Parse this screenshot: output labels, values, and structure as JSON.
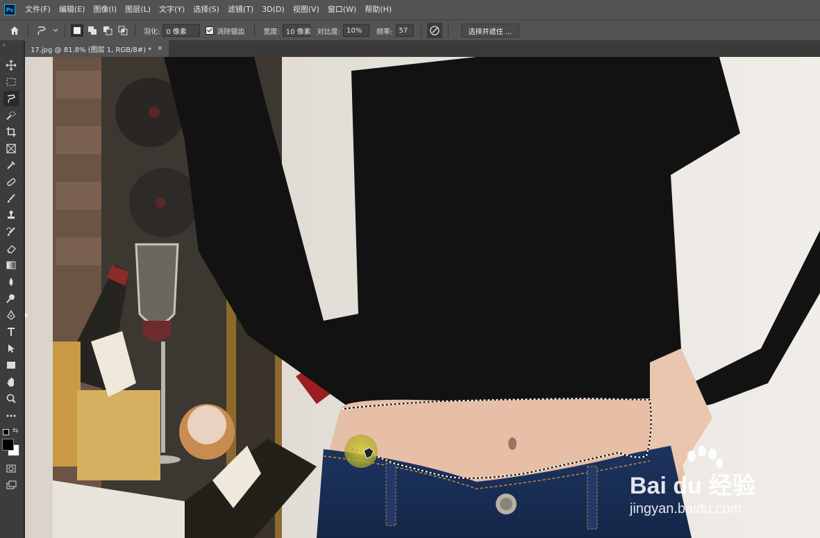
{
  "app": {
    "logo": "Ps"
  },
  "menu": [
    "文件(F)",
    "编辑(E)",
    "图像(I)",
    "图层(L)",
    "文字(Y)",
    "选择(S)",
    "滤镜(T)",
    "3D(D)",
    "视图(V)",
    "窗口(W)",
    "帮助(H)"
  ],
  "options": {
    "feather_label": "羽化:",
    "feather_value": "0 像素",
    "antialias_label": "消除锯齿",
    "antialias_checked": true,
    "width_label": "宽度:",
    "width_value": "10 像素",
    "contrast_label": "对比度:",
    "contrast_value": "10%",
    "frequency_label": "频率:",
    "frequency_value": "57",
    "select_mask_label": "选择并遮住 ..."
  },
  "document": {
    "tab_title": "17.jpg @ 81.8% (图层 1, RGB/8#) *"
  },
  "tools": [
    "move-tool-icon",
    "marquee-tool-icon",
    "magnetic-lasso-tool-icon",
    "quick-selection-tool-icon",
    "crop-tool-icon",
    "frame-tool-icon",
    "eyedropper-tool-icon",
    "healing-brush-tool-icon",
    "brush-tool-icon",
    "clone-stamp-tool-icon",
    "history-brush-tool-icon",
    "eraser-tool-icon",
    "gradient-tool-icon",
    "blur-tool-icon",
    "dodge-tool-icon",
    "pen-tool-icon",
    "type-tool-icon",
    "path-selection-tool-icon",
    "rectangle-tool-icon",
    "hand-tool-icon",
    "zoom-tool-icon",
    "more-tools-icon"
  ],
  "colors": {
    "foreground": "#000000",
    "background": "#ffffff",
    "accent": "#31a8ff"
  },
  "watermark": {
    "brand": "Bai du 经验",
    "url": "jingyan.baidu.com"
  }
}
